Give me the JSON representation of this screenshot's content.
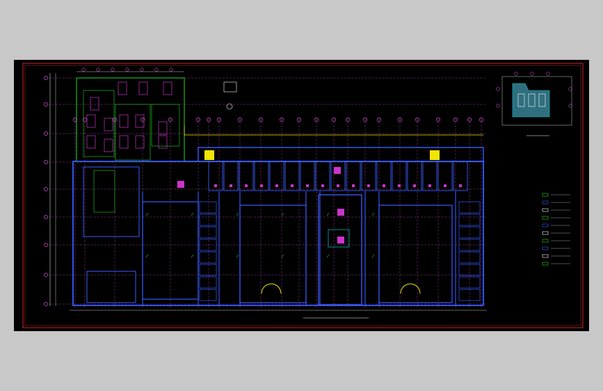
{
  "drawing": {
    "plan_title": "",
    "scale_text": "",
    "site_plan_title": "",
    "legend_title": ""
  },
  "colors": {
    "background": "#c8c8c8",
    "sheet": "#000000",
    "frame": "#ff3333",
    "wall": "#3a5cff",
    "grid_line": "#ff66ff",
    "axis_bubble": "#ff66ff",
    "dimension": "#ffffff",
    "green_lines": "#22dd22",
    "yellow_lines": "#f2e600",
    "cyan": "#00cccc",
    "magenta_fill": "#cc33cc"
  },
  "icons": [
    "axis-bubble-icon",
    "north-arrow-icon"
  ]
}
